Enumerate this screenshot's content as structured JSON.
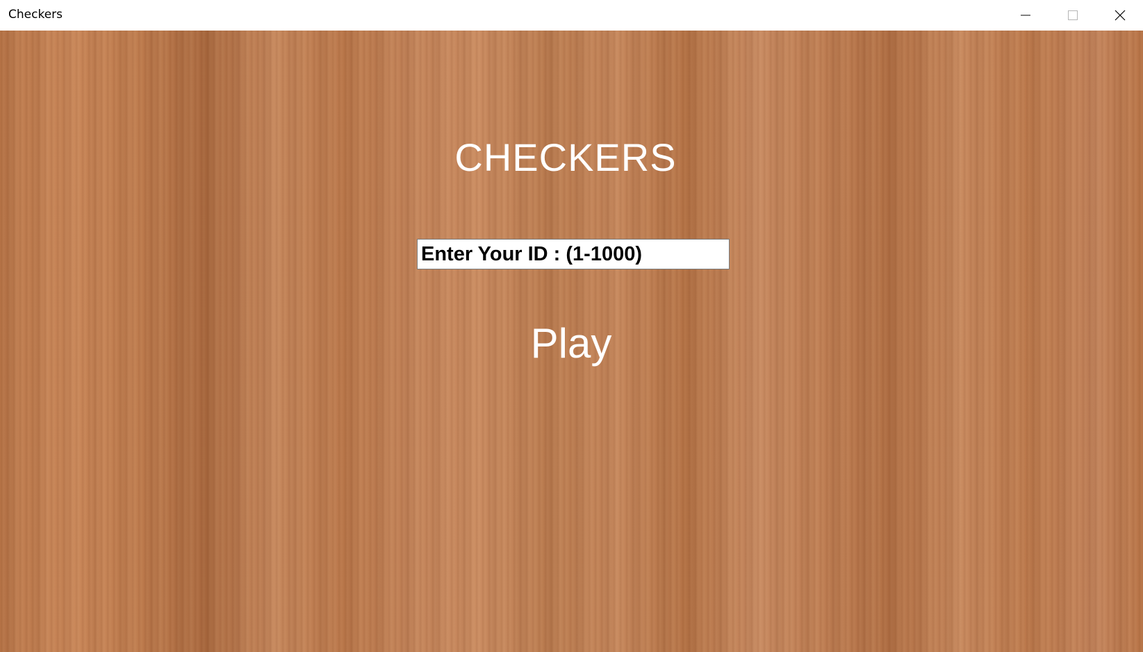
{
  "window": {
    "title": "Checkers",
    "controls": [
      "minimize-icon",
      "maximize-icon",
      "close-icon"
    ]
  },
  "main": {
    "heading": "CHECKERS",
    "id_input": {
      "value": "Enter Your ID : (1-1000)",
      "placeholder": ""
    },
    "play_label": "Play"
  },
  "colors": {
    "titlebar_bg": "#ffffff",
    "wood_base": "#c08055",
    "text_light": "#ffffff",
    "input_bg": "#ffffff",
    "input_text": "#000000"
  }
}
